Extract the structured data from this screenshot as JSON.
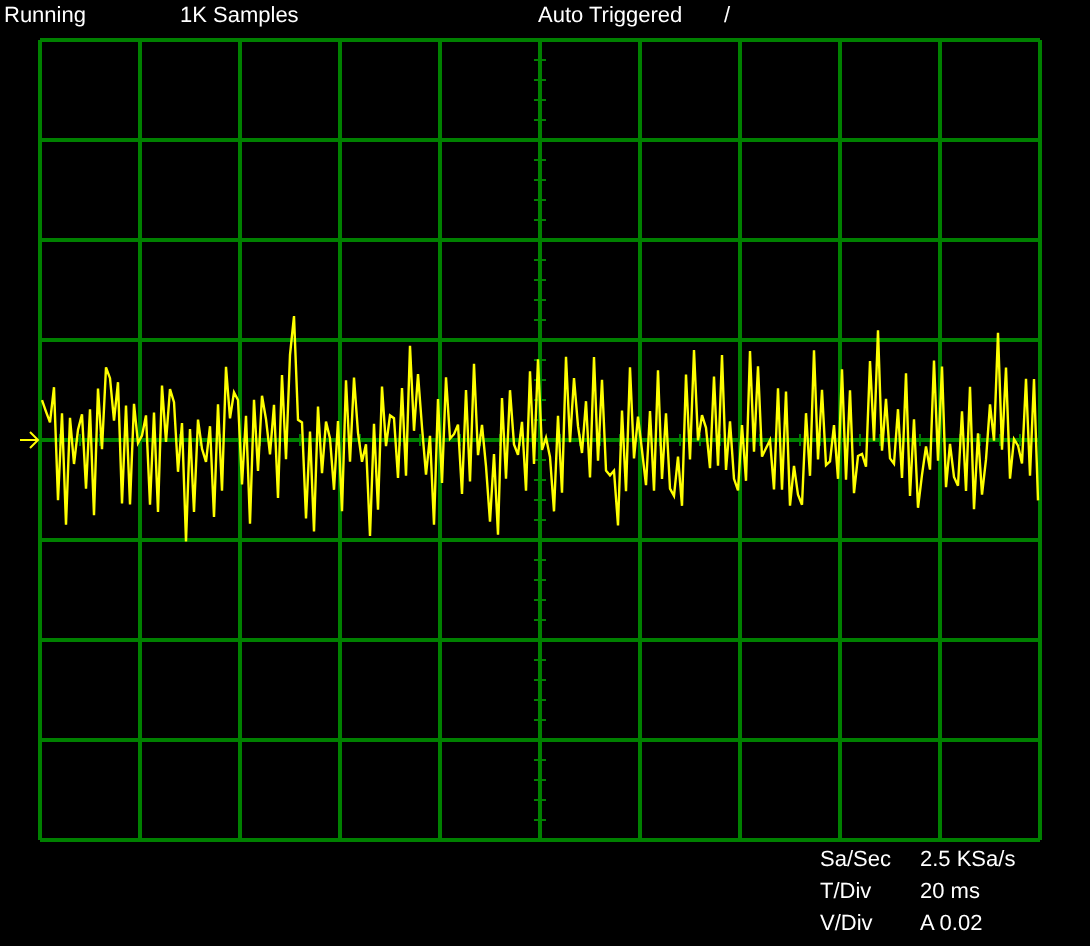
{
  "status_bar": {
    "run_state": "Running",
    "samples": "1K Samples",
    "trigger_mode": "Auto Triggered",
    "trigger_slope": "/"
  },
  "readouts": [
    {
      "label": "Sa/Sec",
      "value": "2.5 KSa/s"
    },
    {
      "label": "T/Div",
      "value": "20 ms"
    },
    {
      "label": "V/Div",
      "value": "A 0.02"
    }
  ]
}
